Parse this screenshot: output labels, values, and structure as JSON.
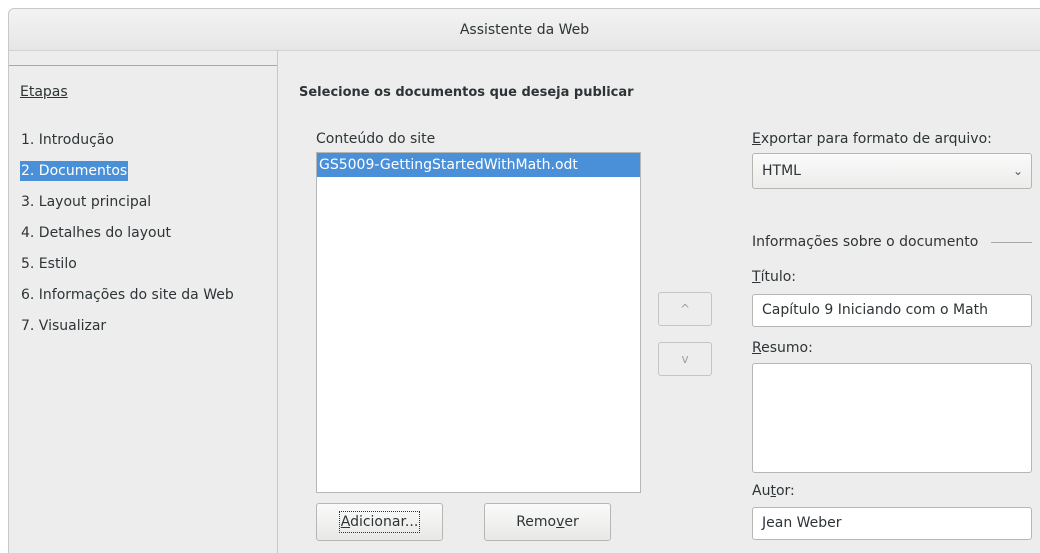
{
  "window": {
    "title": "Assistente da Web"
  },
  "sidebar": {
    "heading": "Etapas",
    "steps": [
      {
        "label": "1. Introdução",
        "active": false
      },
      {
        "label": "2. Documentos",
        "active": true
      },
      {
        "label": "3. Layout principal",
        "active": false
      },
      {
        "label": "4. Detalhes do layout",
        "active": false
      },
      {
        "label": "5. Estilo",
        "active": false
      },
      {
        "label": "6. Informações do site da Web",
        "active": false
      },
      {
        "label": "7. Visualizar",
        "active": false
      }
    ]
  },
  "main": {
    "page_title": "Selecione os documentos que deseja publicar",
    "content_label": "Conteúdo do site",
    "content_items": [
      "GS5009-GettingStartedWithMath.odt"
    ],
    "add_button": {
      "pre": "",
      "mnemonic": "A",
      "post": "dicionar..."
    },
    "remove_button": {
      "pre": "Remo",
      "mnemonic": "v",
      "post": "er"
    },
    "move_up_glyph": "^",
    "move_down_glyph": "v",
    "export_label": {
      "pre": "",
      "mnemonic": "E",
      "post": "xportar para formato de arquivo:"
    },
    "export_format": "HTML",
    "chevron_glyph": "⌄",
    "doc_info_heading": "Informações sobre o documento",
    "title_label": {
      "pre": "",
      "mnemonic": "T",
      "post": "ítulo:"
    },
    "title_value": "Capítulo 9 Iniciando com o Math",
    "summary_label": {
      "pre": "",
      "mnemonic": "R",
      "post": "esumo:"
    },
    "summary_value": "",
    "author_label": {
      "pre": "Au",
      "mnemonic": "t",
      "post": "or:"
    },
    "author_value": "Jean Weber"
  }
}
